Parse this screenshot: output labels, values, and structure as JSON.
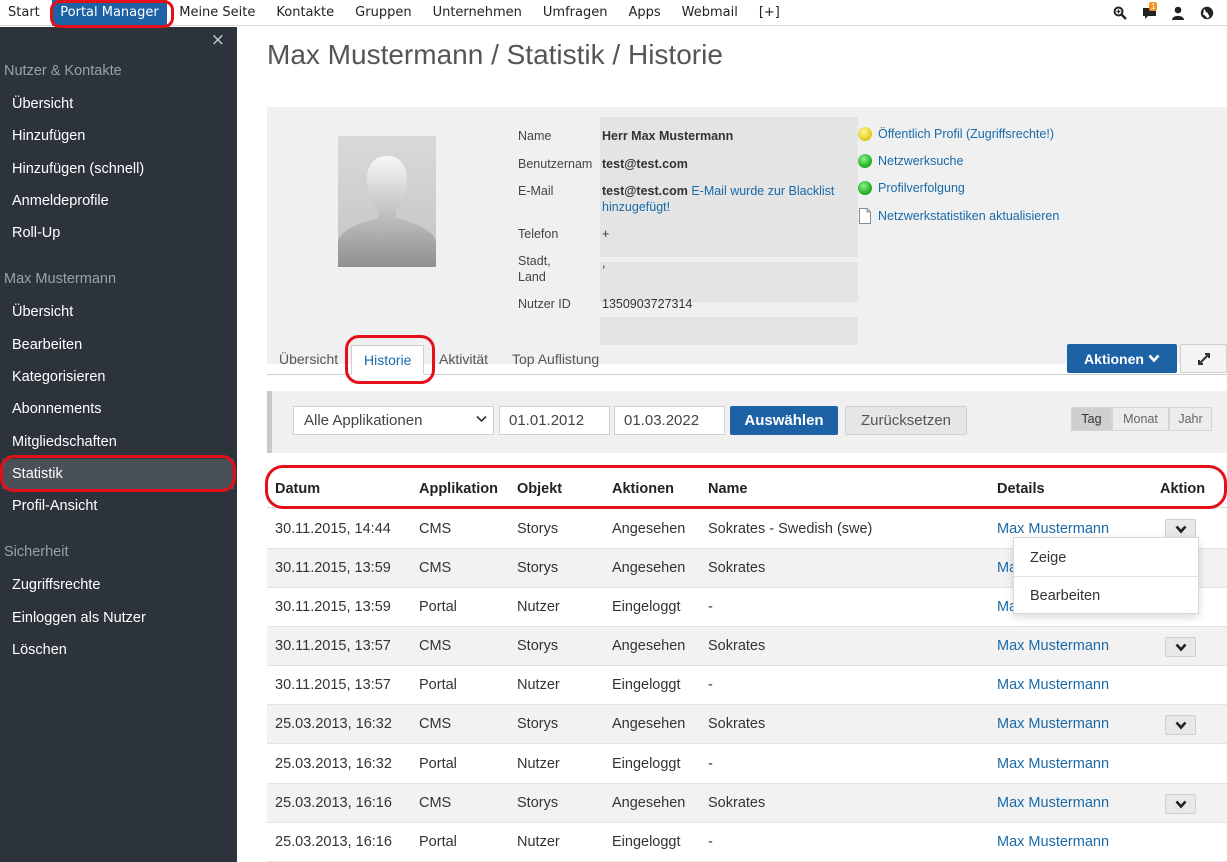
{
  "topnav": {
    "items": [
      "Start",
      "Portal Manager",
      "Meine Seite",
      "Kontakte",
      "Gruppen",
      "Unternehmen",
      "Umfragen",
      "Apps",
      "Webmail",
      "[+]"
    ],
    "active_index": 1,
    "notification_count": "1",
    "icons": [
      "search-icon",
      "chat-icon",
      "user-icon",
      "globe-icon"
    ]
  },
  "sidebar": {
    "close": "×",
    "section_users": "Nutzer & Kontakte",
    "users_items": [
      "Übersicht",
      "Hinzufügen",
      "Hinzufügen (schnell)",
      "Anmeldeprofile",
      "Roll-Up"
    ],
    "section_person": "Max Mustermann",
    "person_items": [
      "Übersicht",
      "Bearbeiten",
      "Kategorisieren",
      "Abonnements",
      "Mitgliedschaften",
      "Statistik",
      "Profil-Ansicht"
    ],
    "active_item": "Statistik",
    "section_security": "Sicherheit",
    "security_items": [
      "Zugriffsrechte",
      "Einloggen als Nutzer",
      "Löschen"
    ]
  },
  "page": {
    "title": "Max Mustermann / Statistik / Historie"
  },
  "profile": {
    "name_label": "Name",
    "name": "Herr Max Mustermann",
    "username_label": "Benutzernam",
    "username": "test@test.com",
    "email_label": "E-Mail",
    "email": "test@test.com",
    "email_note": "E-Mail wurde zur Blacklist hinzugefügt!",
    "phone_label": "Telefon",
    "phone": "+",
    "city_label": "Stadt, Land",
    "city": ",",
    "userid_label": "Nutzer ID",
    "userid": "1350903727314",
    "status": [
      {
        "label": "Öffentlich Profil (Zugriffsrechte!)",
        "icon": "yellow-dot-icon"
      },
      {
        "label": "Netzwerksuche",
        "icon": "green-dot-icon"
      },
      {
        "label": "Profilverfolgung",
        "icon": "green-dot-icon"
      },
      {
        "label": "Netzwerkstatistiken aktualisieren",
        "icon": "document-icon"
      }
    ]
  },
  "tabs": {
    "items": [
      "Übersicht",
      "Historie",
      "Aktivität",
      "Top Auflistung"
    ],
    "active": "Historie",
    "actions_button": "Aktionen"
  },
  "filter": {
    "application": "Alle Applikationen",
    "date_from": "01.01.2012",
    "date_to": "01.03.2022",
    "select_button": "Auswählen",
    "reset_button": "Zurücksetzen",
    "granularity": [
      "Tag",
      "Monat",
      "Jahr"
    ],
    "active_granularity": "Tag"
  },
  "table": {
    "headers": [
      "Datum",
      "Applikation",
      "Objekt",
      "Aktionen",
      "Name",
      "Details",
      "Aktion"
    ],
    "rows": [
      {
        "date": "30.11.2015, 14:44",
        "app": "CMS",
        "object": "Storys",
        "action": "Angesehen",
        "name": "Sokrates - Swedish (swe)",
        "details": "Max Mustermann",
        "has_menu": true
      },
      {
        "date": "30.11.2015, 13:59",
        "app": "CMS",
        "object": "Storys",
        "action": "Angesehen",
        "name": "Sokrates",
        "details": "Ma",
        "has_menu": false
      },
      {
        "date": "30.11.2015, 13:59",
        "app": "Portal",
        "object": "Nutzer",
        "action": "Eingeloggt",
        "name": "-",
        "details": "Ma",
        "has_menu": false
      },
      {
        "date": "30.11.2015, 13:57",
        "app": "CMS",
        "object": "Storys",
        "action": "Angesehen",
        "name": "Sokrates",
        "details": "Max Mustermann",
        "has_menu": true
      },
      {
        "date": "30.11.2015, 13:57",
        "app": "Portal",
        "object": "Nutzer",
        "action": "Eingeloggt",
        "name": "-",
        "details": "Max Mustermann",
        "has_menu": false
      },
      {
        "date": "25.03.2013, 16:32",
        "app": "CMS",
        "object": "Storys",
        "action": "Angesehen",
        "name": "Sokrates",
        "details": "Max Mustermann",
        "has_menu": true
      },
      {
        "date": "25.03.2013, 16:32",
        "app": "Portal",
        "object": "Nutzer",
        "action": "Eingeloggt",
        "name": "-",
        "details": "Max Mustermann",
        "has_menu": false
      },
      {
        "date": "25.03.2013, 16:16",
        "app": "CMS",
        "object": "Storys",
        "action": "Angesehen",
        "name": "Sokrates",
        "details": "Max Mustermann",
        "has_menu": true
      },
      {
        "date": "25.03.2013, 16:16",
        "app": "Portal",
        "object": "Nutzer",
        "action": "Eingeloggt",
        "name": "-",
        "details": "Max Mustermann",
        "has_menu": false
      }
    ],
    "dropdown": [
      "Zeige",
      "Bearbeiten"
    ]
  },
  "colors": {
    "primary": "#1d62a4",
    "sidebar": "#2c333b",
    "link": "#1a6aa8",
    "annotation": "#e3101a"
  }
}
